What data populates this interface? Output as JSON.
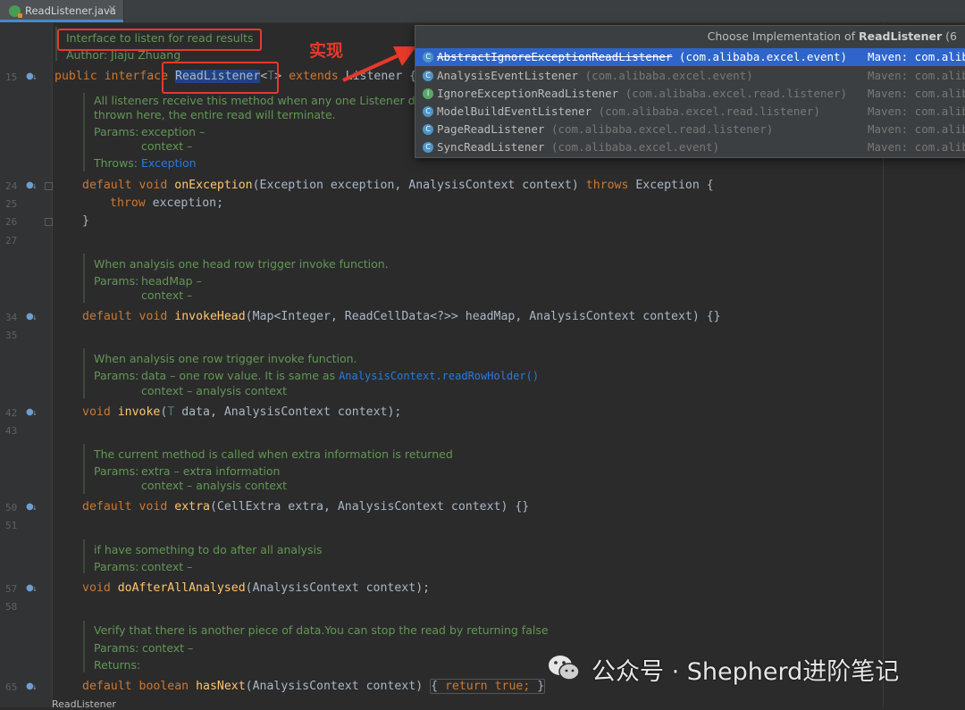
{
  "tab": {
    "file_name": "ReadListener.java",
    "close": "×"
  },
  "annotation": {
    "label": "实现"
  },
  "javadoc_top": {
    "line1": "Interface to listen for read results",
    "line2": "Author: Jiaju Zhuang"
  },
  "line_numbers": {
    "l15": "15",
    "l24": "24",
    "l25": "25",
    "l26": "26",
    "l27": "27",
    "l34": "34",
    "l35": "35",
    "l42": "42",
    "l43": "43",
    "l50": "50",
    "l51": "51",
    "l57": "57",
    "l58": "58",
    "l65": "65"
  },
  "declaration": {
    "public": "public",
    "interface": "interface",
    "name": "ReadListener",
    "generic_open": "<",
    "type_param": "T",
    "generic_close": ">",
    "extends": "extends",
    "parent": "Listener {"
  },
  "doc_on_exception": {
    "line1": "All listeners receive this method when any one Listener does an error report. If an exception is",
    "line2": "thrown here, the entire read will terminate.",
    "params_label": "Params:",
    "param1": "exception –",
    "param2": "context –",
    "throws_label": "Throws:",
    "throws_link": "Exception"
  },
  "code_on_exception": {
    "default": "default",
    "void": "void",
    "name": "onException",
    "args": "(Exception exception, AnalysisContext context) ",
    "throws": "throws",
    "rest": " Exception {",
    "throw_kw": "throw",
    "throw_rest": " exception;",
    "close": "}"
  },
  "doc_invoke_head": {
    "line1": "When analysis one head row trigger invoke function.",
    "params_label": "Params:",
    "param1": "headMap –",
    "param2": "context –"
  },
  "code_invoke_head": {
    "default": "default",
    "void": "void",
    "name": "invokeHead",
    "args": "(Map<Integer, ReadCellData<?>> headMap, AnalysisContext context) {}"
  },
  "doc_invoke": {
    "line1": "When analysis one row trigger invoke function.",
    "params_label": "Params:",
    "param1": "data – one row value. It is same as ",
    "param1_link": "AnalysisContext.readRowHolder()",
    "param2": "context – analysis context"
  },
  "code_invoke": {
    "void": "void",
    "name": "invoke",
    "open": "(",
    "type_param": "T",
    "args": " data, AnalysisContext context);"
  },
  "doc_extra": {
    "line1": "The current method is called when extra information is returned",
    "params_label": "Params:",
    "param1": "extra – extra information",
    "param2": "context – analysis context"
  },
  "code_extra": {
    "default": "default",
    "void": "void",
    "name": "extra",
    "args": "(CellExtra extra, AnalysisContext context) {}"
  },
  "doc_after": {
    "line1": "if have something to do after all analysis",
    "params_label": "Params:",
    "param1": "context –"
  },
  "code_after": {
    "void": "void",
    "name": "doAfterAllAnalysed",
    "args": "(AnalysisContext context);"
  },
  "doc_has_next": {
    "line1": "Verify that there is another piece of data.You can stop the read by returning false",
    "params_label": "Params:",
    "param1": " context –",
    "returns_label": "Returns:"
  },
  "code_has_next": {
    "default": "default",
    "boolean": "boolean",
    "name": "hasNext",
    "args": "(AnalysisContext context) ",
    "open_brace": "{",
    "return_kw": "return",
    "true_kw": "true;",
    "close_brace": "}"
  },
  "popup": {
    "title_prefix": "Choose Implementation of ",
    "title_bold": "ReadListener",
    "title_suffix": " (6",
    "items": [
      {
        "name": "AbstractIgnoreExceptionReadListener",
        "pkg": " (com.alibaba.excel.event)",
        "maven": "Maven: com.alib",
        "icon": "C"
      },
      {
        "name": "AnalysisEventListener",
        "pkg": " (com.alibaba.excel.event)",
        "maven": "Maven: com.alib",
        "icon": "C"
      },
      {
        "name": "IgnoreExceptionReadListener",
        "pkg": " (com.alibaba.excel.read.listener)",
        "maven": "Maven: com.alib",
        "icon": "I"
      },
      {
        "name": "ModelBuildEventListener",
        "pkg": " (com.alibaba.excel.read.listener)",
        "maven": "Maven: com.alib",
        "icon": "C"
      },
      {
        "name": "PageReadListener",
        "pkg": " (com.alibaba.excel.read.listener)",
        "maven": "Maven: com.alib",
        "icon": "C"
      },
      {
        "name": "SyncReadListener",
        "pkg": " (com.alibaba.excel.event)",
        "maven": "Maven: com.alib",
        "icon": "C"
      }
    ]
  },
  "watermark": {
    "text": "公众号 · Shepherd进阶笔记"
  },
  "status_bar": {
    "crumb": "ReadListener"
  },
  "colors": {
    "accent_red": "#e8392a",
    "selection_blue": "#2f65ca",
    "doc_green": "#629755",
    "keyword_orange": "#cc7832",
    "method_yellow": "#ffc66d"
  },
  "icons": {
    "file": "java-interface-icon",
    "gutter": "implemented-marker-icon",
    "class": "class-icon",
    "interface": "interface-icon",
    "watermark": "wechat-icon"
  }
}
